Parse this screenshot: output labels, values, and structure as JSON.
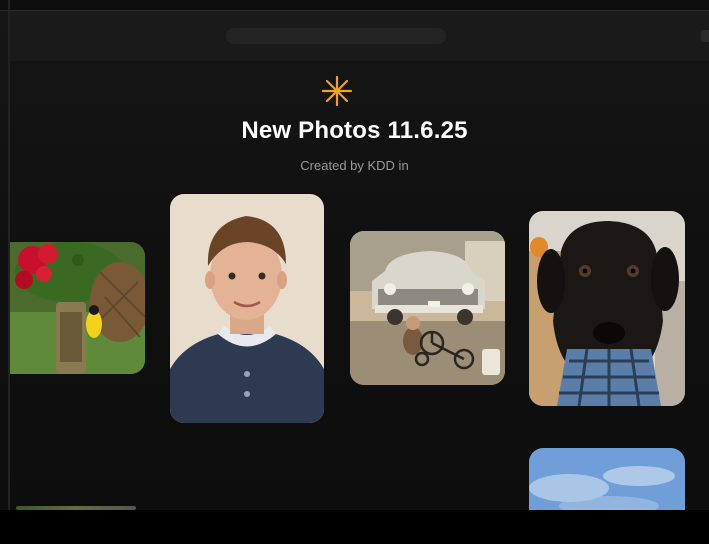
{
  "album": {
    "title": "New Photos 11.6.25",
    "subtitle": "Created by KDD in"
  },
  "icons": {
    "header_icon": "sparkle-asterisk-icon"
  },
  "colors": {
    "accent": "#f2a21b",
    "background": "#111111",
    "title": "#ffffff",
    "subtitle": "#9a9a9a"
  },
  "photos": [
    {
      "name": "flowers-bird-feeder"
    },
    {
      "name": "boy-portrait"
    },
    {
      "name": "vintage-car-tricycle"
    },
    {
      "name": "black-dog-bandana"
    },
    {
      "name": "sky-clouds"
    }
  ]
}
